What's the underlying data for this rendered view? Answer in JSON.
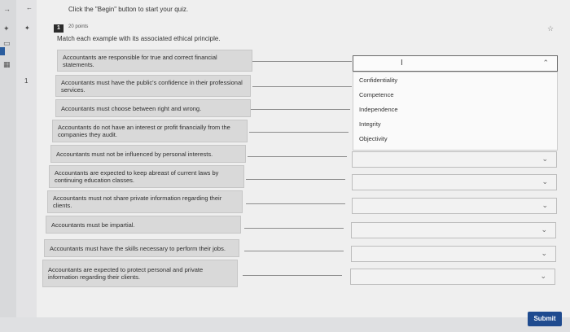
{
  "instruction": "Click the \"Begin\" button to start your quiz.",
  "question": {
    "number": "1",
    "points": "20 points",
    "prompt": "Match each example with its associated ethical principle."
  },
  "left_column": {
    "item_number": "1"
  },
  "statements": [
    "Accountants are responsible for true and correct financial statements.",
    "Accountants must have the public's confidence in their professional services.",
    "Accountants must choose between right and wrong.",
    "Accountants do not have an interest or profit financially from the companies they audit.",
    "Accountants must not be influenced by personal interests.",
    "Accountants are expected to keep abreast of current laws by continuing education classes.",
    "Accountants must not share private information regarding their clients.",
    "Accountants must be impartial.",
    "Accountants must have the skills necessary to perform their jobs.",
    "Accountants are expected to protect personal and private information regarding their clients."
  ],
  "dropdown_options": [
    "Confidentiality",
    "Competence",
    "Independence",
    "Integrity",
    "Objectivity"
  ],
  "submit_label": "Submit",
  "icons": {
    "chevron_up": "⌃",
    "chevron_down": "⌄",
    "text_cursor": "I",
    "pin": "☆"
  },
  "colors": {
    "submit": "#1f4b8f",
    "badge": "#2c2c2c"
  }
}
